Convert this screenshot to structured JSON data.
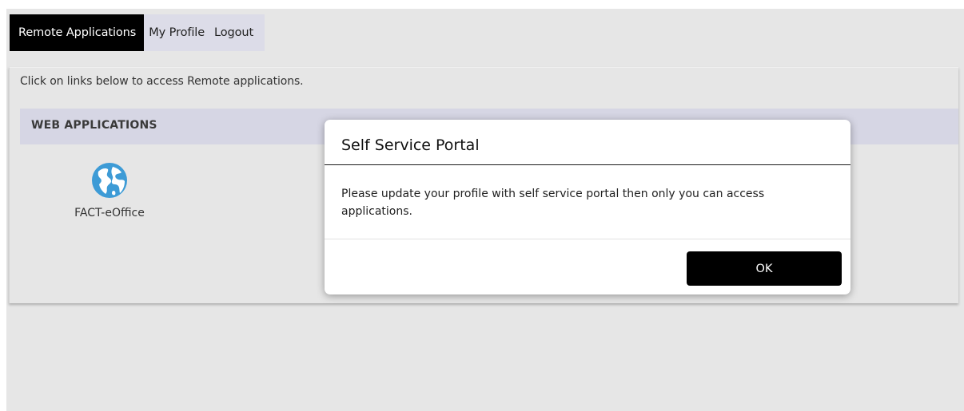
{
  "nav": {
    "items": [
      {
        "label": "Remote Applications",
        "active": true
      },
      {
        "label": "My Profile",
        "active": false
      },
      {
        "label": "Logout",
        "active": false
      }
    ]
  },
  "main": {
    "intro_text": "Click on links below to access Remote applications.",
    "section_title": "WEB APPLICATIONS",
    "apps": [
      {
        "label": "FACT-eOffice",
        "icon": "globe-icon"
      }
    ]
  },
  "modal": {
    "title": "Self Service Portal",
    "message": "Please update your profile with self service portal then only you can access applications.",
    "ok_label": "OK"
  },
  "colors": {
    "nav_active_bg": "#000000",
    "nav_bg": "#dcdce8",
    "page_bg": "#e6e6e6",
    "section_header_bg": "#d6d6e4",
    "globe_blue": "#3d9bd6",
    "button_bg": "#000000"
  }
}
